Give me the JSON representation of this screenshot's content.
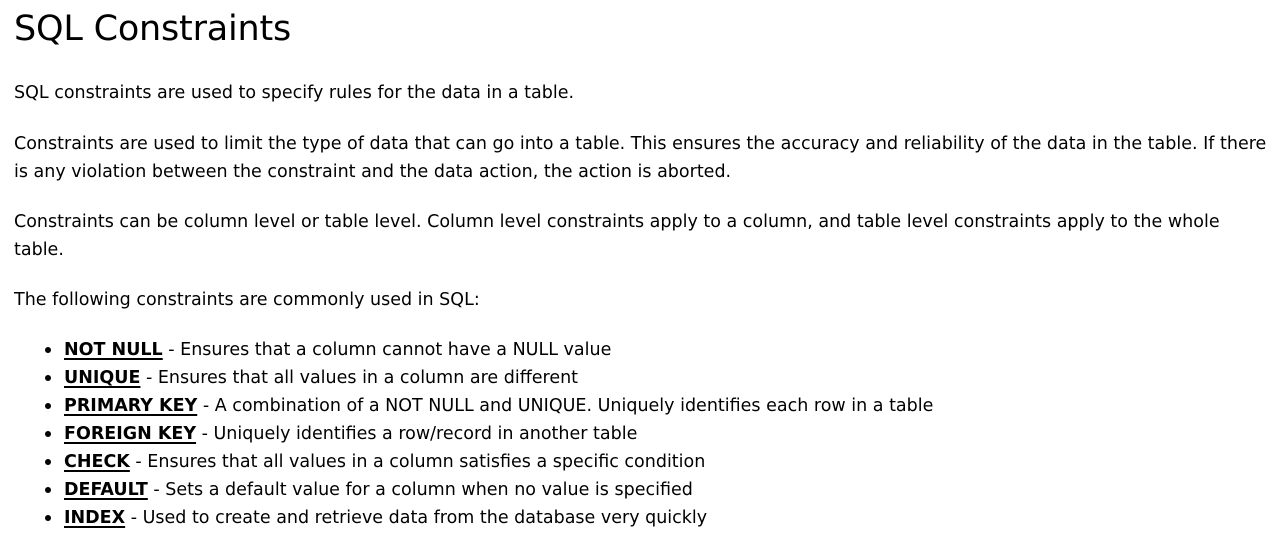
{
  "page": {
    "title": "SQL Constraints",
    "paragraphs": [
      "SQL constraints are used to specify rules for the data in a table.",
      "Constraints are used to limit the type of data that can go into a table. This ensures the accuracy and reliability of the data in the table. If there is any violation between the constraint and the data action, the action is aborted.",
      "Constraints can be column level or table level. Column level constraints apply to a column, and table level constraints apply to the whole table.",
      "The following constraints are commonly used in SQL:"
    ],
    "constraints": [
      {
        "term": "NOT NULL",
        "description": " - Ensures that a column cannot have a NULL value"
      },
      {
        "term": "UNIQUE",
        "description": " - Ensures that all values in a column are different"
      },
      {
        "term": "PRIMARY KEY",
        "description": " - A combination of a NOT NULL and UNIQUE. Uniquely identifies each row in a table"
      },
      {
        "term": "FOREIGN KEY",
        "description": " - Uniquely identifies a row/record in another table"
      },
      {
        "term": "CHECK",
        "description": " - Ensures that all values in a column satisfies a specific condition"
      },
      {
        "term": "DEFAULT",
        "description": " - Sets a default value for a column when no value is specified"
      },
      {
        "term": "INDEX",
        "description": " - Used to create and retrieve data from the database very quickly"
      }
    ]
  }
}
